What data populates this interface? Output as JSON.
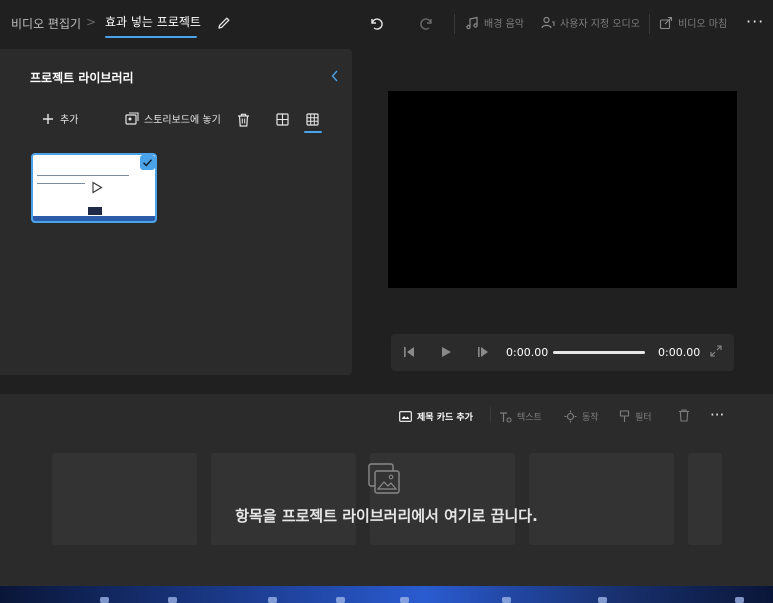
{
  "breadcrumb": {
    "root": "비디오 편집기",
    "separator": ">",
    "current": "효과 넣는 프로젝트"
  },
  "toolbar": {
    "background_music": "배경 음악",
    "custom_audio": "사용자 지정 오디오",
    "finish_video": "비디오 마침",
    "more": "···"
  },
  "library": {
    "title": "프로젝트 라이브러리",
    "add_label": "추가",
    "place_in_storyboard": "스토리보드에 놓기"
  },
  "player": {
    "current_time": "0:00.00",
    "total_time": "0:00.00"
  },
  "storyboard": {
    "title_card": "제목 카드 추가",
    "text": "텍스트",
    "motion": "동작",
    "filters": "필터",
    "more": "···",
    "drop_hint": "항목을 프로젝트 라이브러리에서 여기로 끕니다."
  },
  "colors": {
    "accent": "#4aa3e8",
    "panel": "#2b2b2b",
    "background": "#202020"
  }
}
